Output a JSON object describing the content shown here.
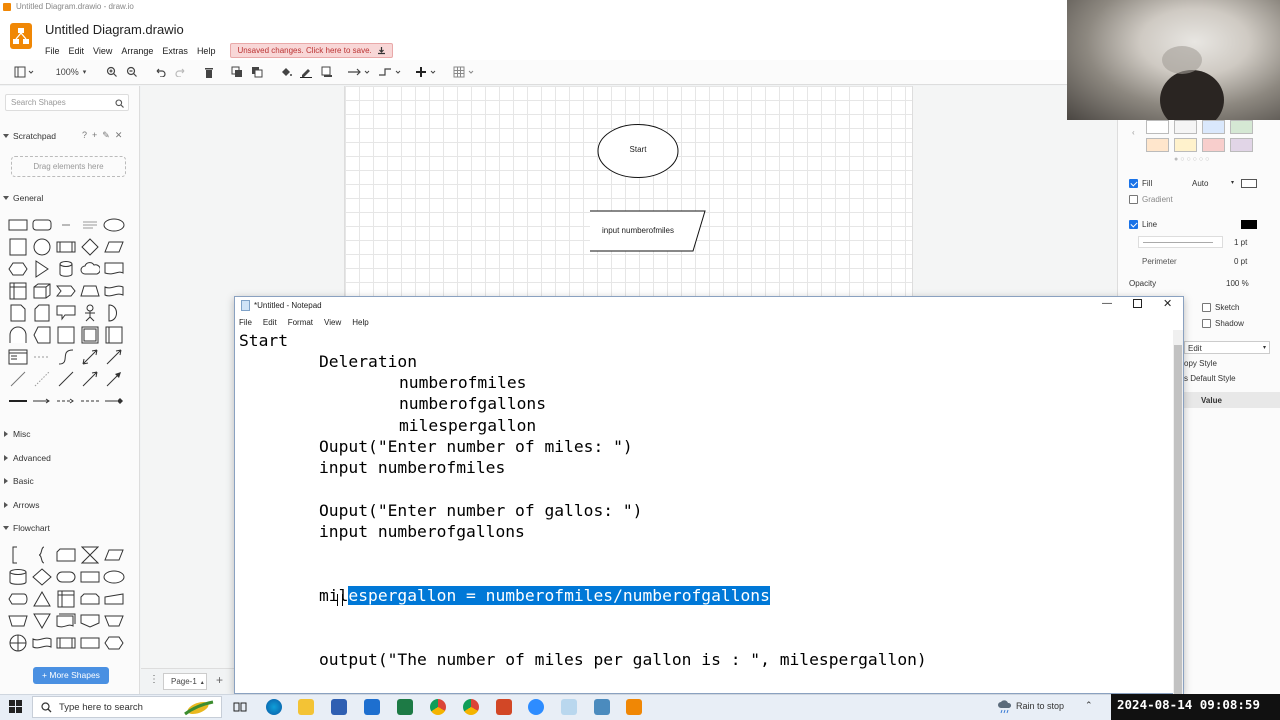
{
  "window_title": "Untitled Diagram.drawio - draw.io",
  "drawio": {
    "doc_title": "Untitled Diagram.drawio",
    "menu": [
      "File",
      "Edit",
      "View",
      "Arrange",
      "Extras",
      "Help"
    ],
    "unsaved_notice": "Unsaved changes. Click here to save.",
    "zoom": "100%",
    "search_placeholder": "Search Shapes",
    "scratchpad_label": "Scratchpad",
    "drop_hint": "Drag elements here",
    "sections": {
      "general": "General",
      "misc": "Misc",
      "advanced": "Advanced",
      "basic": "Basic",
      "arrows": "Arrows",
      "flowchart": "Flowchart"
    },
    "more_shapes": "+ More Shapes",
    "page_tab": "Page-1",
    "diagram": {
      "start_label": "Start",
      "input_label": "input numberofmiles"
    },
    "format_panel": {
      "fill_label": "Fill",
      "fill_value": "Auto",
      "gradient_label": "Gradient",
      "line_label": "Line",
      "line_width": "1 pt",
      "perimeter_label": "Perimeter",
      "perimeter_value": "0 pt",
      "opacity_label": "Opacity",
      "opacity_value": "100 %",
      "sketch_label": "Sketch",
      "shadow_label": "Shadow",
      "edit_label": "Edit",
      "copy_style": "opy Style",
      "default_style": "s Default Style",
      "value_header": "Value"
    },
    "colors": {
      "accent": "#f08705",
      "unsaved_bg": "#f8d7d7",
      "more_shapes_bg": "#4a90e2"
    }
  },
  "notepad": {
    "title": "*Untitled - Notepad",
    "menu": [
      "File",
      "Edit",
      "Format",
      "View",
      "Help"
    ],
    "lines": {
      "l1": "Start",
      "l2": "Deleration",
      "l3": "numberofmiles",
      "l4": "numberofgallons",
      "l5": "milespergallon",
      "l6": "Ouput(\"Enter number of miles: \")",
      "l7": "input numberofmiles",
      "l8": "Ouput(\"Enter number of gallos: \")",
      "l9": "input numberofgallons",
      "l10_pre": "mil",
      "l10_sel": "espergallon = numberofmiles/numberofgallons",
      "l11": "output(\"The number of miles per gallon is : \", milespergallon)"
    },
    "selection_color": "#0078d7"
  },
  "taskbar": {
    "search_placeholder": "Type here to search",
    "weather": "Rain to stop",
    "timestamp": "2024-08-14 09:08:59"
  }
}
